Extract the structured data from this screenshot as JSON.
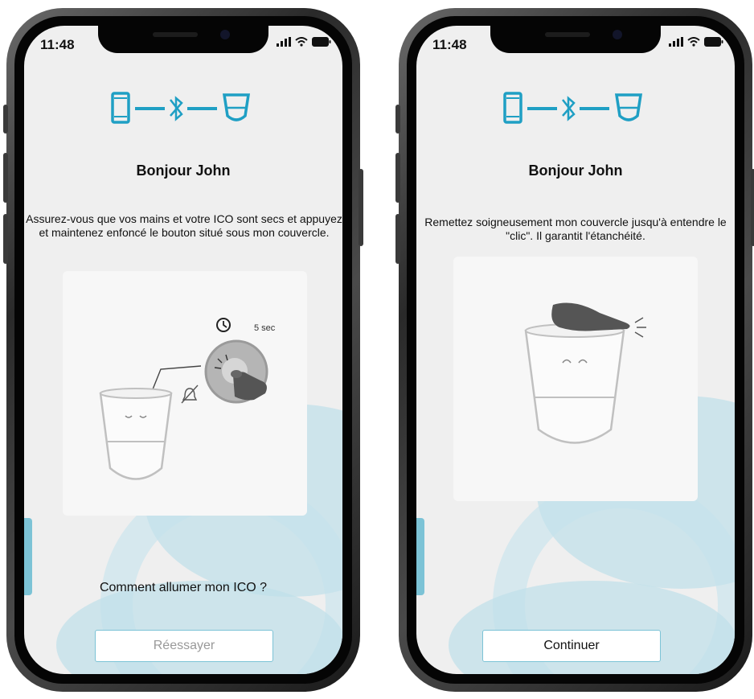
{
  "screens": [
    {
      "status": {
        "time": "11:48"
      },
      "title": "Bonjour John",
      "description": "Assurez-vous que vos mains et votre ICO sont secs et appuyez et maintenez enfoncé le bouton situé sous mon couvercle.",
      "illustration": {
        "timer_label": "5 sec"
      },
      "help_link": "Comment allumer mon ICO ?",
      "button": {
        "label": "Réessayer",
        "state": "disabled"
      }
    },
    {
      "status": {
        "time": "11:48"
      },
      "title": "Bonjour John",
      "description": "Remettez soigneusement mon couvercle jusqu'à entendre le \"clic\". Il garantit l'étanchéité.",
      "button": {
        "label": "Continuer",
        "state": "enabled"
      }
    }
  ],
  "icons": [
    "phone-icon",
    "bluetooth-icon",
    "ico-device-icon",
    "signal-icon",
    "wifi-icon",
    "battery-icon",
    "clock-icon",
    "hand-icon"
  ],
  "colors": {
    "accent": "#1f9fc4",
    "screen_bg": "#efefef",
    "button_border": "#7cc3d6"
  }
}
